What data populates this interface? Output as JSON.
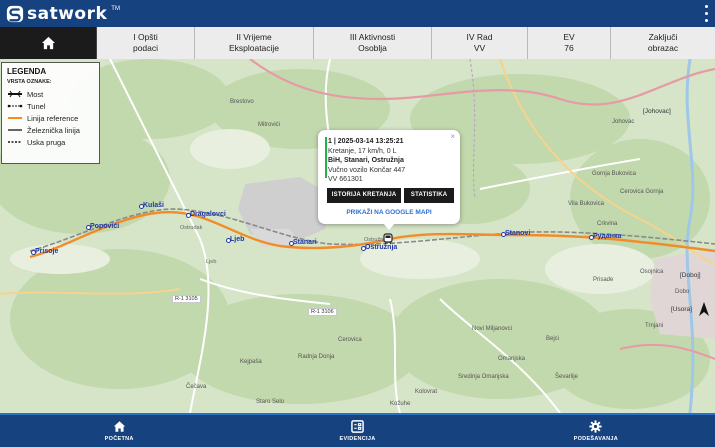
{
  "header": {
    "brand": "satwork",
    "brand_tm": "TM",
    "menu_icon": "kebab-menu-icon"
  },
  "tabs": [
    {
      "id": "home",
      "icon": "home-icon",
      "line1": "",
      "line2": ""
    },
    {
      "id": "opsti",
      "line1": "I Opšti",
      "line2": "podaci"
    },
    {
      "id": "vrijeme",
      "line1": "II Vrijeme",
      "line2": "Eksploatacije"
    },
    {
      "id": "aktivnosti",
      "line1": "III Aktivnosti",
      "line2": "Osoblja"
    },
    {
      "id": "rad",
      "line1": "IV Rad",
      "line2": "VV"
    },
    {
      "id": "ev",
      "line1": "EV",
      "line2": "76"
    },
    {
      "id": "zakljuci",
      "line1": "Zaključi",
      "line2": "obrazac"
    }
  ],
  "legend": {
    "title": "LEGENDA",
    "subtitle": "VRSTA OZNAKE:",
    "items": [
      "Most",
      "Tunel",
      "Linija reference",
      "Železnička linija",
      "Uska pruga"
    ]
  },
  "popup": {
    "title": "1 | 2025-03-14 13:25:21",
    "motion": "Kretanje, 17 km/h, 0 L",
    "location": "BiH, Stanari, Ostružnja",
    "vehicle": "Vučno vozilo Končar 447",
    "id": "VV 661301",
    "btn_history": "ISTORIJA KRETANJA",
    "btn_stats": "STATISTIKA",
    "google_link": "PRIKAŽI NA GOOGLE MAPI",
    "close": "×"
  },
  "map_labels": {
    "stations": [
      "Prisoje",
      "Popovići",
      "Kulaši",
      "Dragalovci",
      "Ljeb",
      "Stanari",
      "Ostružnja",
      "Stanovi",
      "Руданка"
    ],
    "places": [
      "Brestovo",
      "Mitrovići",
      "Ostružnja",
      "Ostrudak",
      "Ljeb",
      "Cerovica",
      "Radnja Donja",
      "Kolovrat",
      "Čečava",
      "Kejpaša",
      "Kožuhe",
      "Staro Selo",
      "Novi Miljanovci",
      "Bejci",
      "Sredinja Omanjska",
      "Omanjska",
      "Ševarlije",
      "Johovac",
      "Prisade",
      "Osojnica",
      "Crkvina",
      "Trnjani",
      "Dobo",
      "Cerovica Gornja",
      "Vila Bukovica",
      "Gornja Bukovica"
    ],
    "brackets": [
      "[Johovac]",
      "[Doboj]",
      "[Usora]"
    ],
    "roads": [
      "R-1 3105",
      "R-1 3106"
    ]
  },
  "bottom_nav": [
    {
      "id": "pocetna",
      "icon": "home-icon",
      "label": "POČETNA"
    },
    {
      "id": "evidencija",
      "icon": "records-icon",
      "label": "EVIDENCIJA"
    },
    {
      "id": "podesavanja",
      "icon": "gear-icon",
      "label": "PODEŠAVANJA"
    }
  ],
  "colors": {
    "brand": "#16427f",
    "reference_line": "#f28c28",
    "status_active": "#22b14c",
    "station": "#1d38a6"
  }
}
